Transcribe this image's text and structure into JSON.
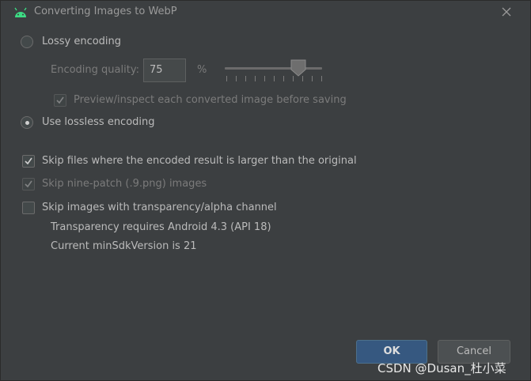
{
  "window": {
    "title": "Converting Images to WebP",
    "icon": "android-icon"
  },
  "encoding": {
    "lossy_label": "Lossy encoding",
    "lossy_selected": false,
    "quality_label": "Encoding quality:",
    "quality_value": "75",
    "quality_unit": "%",
    "quality_slider_value": 75,
    "preview_label": "Preview/inspect each converted image before saving",
    "preview_checked": true,
    "lossless_label": "Use lossless encoding",
    "lossless_selected": true
  },
  "options": {
    "skip_larger_label": "Skip files where the encoded result is larger than the original",
    "skip_larger_checked": true,
    "skip_ninepatch_label": "Skip nine-patch (.9.png) images",
    "skip_ninepatch_checked": true,
    "skip_alpha_label": "Skip images with transparency/alpha channel",
    "skip_alpha_checked": false,
    "alpha_note_1": "Transparency requires Android 4.3 (API 18)",
    "alpha_note_2": "Current minSdkVersion is 21"
  },
  "buttons": {
    "ok_label": "OK",
    "cancel_label": "Cancel"
  },
  "watermark": "CSDN @Dusan_杜小菜",
  "colors": {
    "background": "#3c3f41",
    "primary_button": "#365880",
    "android_green": "#3ddc84"
  }
}
